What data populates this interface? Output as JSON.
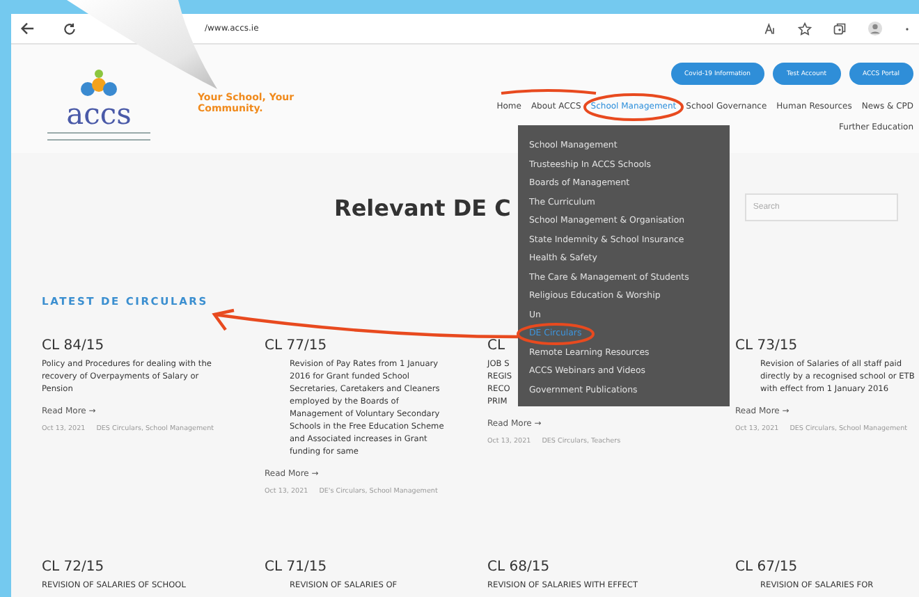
{
  "browser": {
    "url": "/www.accs.ie"
  },
  "header": {
    "logo_text": "accs",
    "tagline": "Your School, Your Community."
  },
  "top_buttons": [
    "Covid-19 Information",
    "Test Account",
    "ACCS Portal"
  ],
  "nav_rows": [
    [
      {
        "label": "Home",
        "selected": false
      },
      {
        "label": "About ACCS",
        "selected": false
      },
      {
        "label": "School Management",
        "selected": true
      },
      {
        "label": "School Governance",
        "selected": false
      },
      {
        "label": "Human Resources",
        "selected": false
      },
      {
        "label": "News & CPD",
        "selected": false
      }
    ],
    [
      {
        "label": "Further Education",
        "selected": false
      }
    ]
  ],
  "dropdown": {
    "items": [
      {
        "label": "School Management",
        "selected": false
      },
      {
        "label": "Trusteeship In ACCS Schools",
        "selected": false
      },
      {
        "label": "Boards of Management",
        "selected": false
      },
      {
        "label": "The Curriculum",
        "selected": false
      },
      {
        "label": "School Management & Organisation",
        "selected": false
      },
      {
        "label": "State Indemnity & School Insurance",
        "selected": false
      },
      {
        "label": "Health & Safety",
        "selected": false
      },
      {
        "label": "The Care & Management of Students",
        "selected": false
      },
      {
        "label": "Religious Education & Worship",
        "selected": false
      },
      {
        "label": "Un",
        "selected": false
      },
      {
        "label": "DE Circulars",
        "selected": true
      },
      {
        "label": "Remote Learning Resources",
        "selected": false
      },
      {
        "label": "ACCS Webinars and Videos",
        "selected": false
      },
      {
        "label": "Government Publications",
        "selected": false
      }
    ]
  },
  "heading": "Relevant DE C",
  "search": {
    "placeholder": "Search"
  },
  "section_title": "LATEST DE CIRCULARS",
  "cards": [
    {
      "title": "CL 84/15",
      "body": "Policy and Procedures for dealing with the recovery of Overpayments of Salary or Pension",
      "indented": false,
      "read_more": "Read More →",
      "date": "Oct 13, 2021",
      "categories": "DES Circulars, School Management"
    },
    {
      "title": "CL 77/15",
      "body": "Revision of Pay Rates from 1 January 2016 for Grant funded School Secretaries, Caretakers and Cleaners employed by the Boards of Management of Voluntary Secondary Schools in the Free Education Scheme and Associated increases in Grant funding for same",
      "indented": true,
      "read_more": "Read More →",
      "date": "Oct 13, 2021",
      "categories": "DE's Circulars, School Management"
    },
    {
      "title": "CL",
      "body": "JOB S\nREGIS\nRECO\nPRIM",
      "indented": false,
      "read_more": "Read More →",
      "date": "Oct 13, 2021",
      "categories": "DES Circulars, Teachers"
    },
    {
      "title": "CL 73/15",
      "body": "Revision of Salaries of all staff paid directly by a recognised school or ETB with effect from 1 January 2016",
      "indented": true,
      "read_more": "Read More →",
      "date": "Oct 13, 2021",
      "categories": "DES Circulars, School Management"
    },
    {
      "title": "CL 72/15",
      "body": "REVISION OF SALARIES OF SCHOOL",
      "indented": false
    },
    {
      "title": "CL 71/15",
      "body": "REVISION OF SALARIES OF",
      "indented": true
    },
    {
      "title": "CL 68/15",
      "body": "REVISION OF SALARIES WITH EFFECT",
      "indented": false
    },
    {
      "title": "CL 67/15",
      "body": "REVISION OF SALARIES FOR",
      "indented": true
    }
  ]
}
